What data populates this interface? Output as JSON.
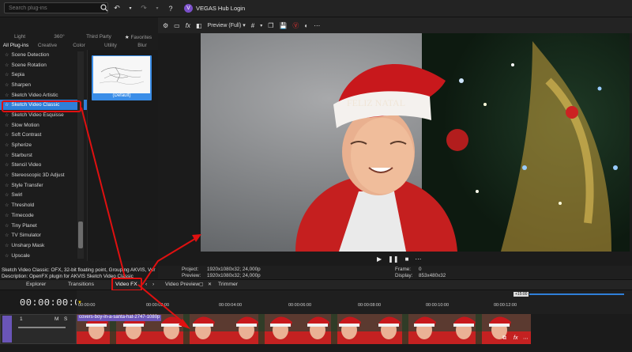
{
  "window": {
    "title": "VEGAS Hub Login",
    "logo_letter": "V"
  },
  "plugin_panel": {
    "search_placeholder": "Search plug-ins",
    "category_row1": [
      "Light",
      "360°",
      "Third Party",
      "Favorites"
    ],
    "category_row2": [
      "All Plug-ins",
      "Creative",
      "Color",
      "Utility",
      "Blur"
    ],
    "plugins": [
      "Scene Detection",
      "Scene Rotation",
      "Sepia",
      "Sharpen",
      "Sketch Video Artistic",
      "Sketch Video Classic",
      "Sketch Video Esquisse",
      "Slow Motion",
      "Soft Contrast",
      "Spherize",
      "Starburst",
      "Stencil Video",
      "Stereoscopic 3D Adjust",
      "Style Transfer",
      "Swirl",
      "Threshold",
      "Timecode",
      "Tiny Planet",
      "TV Simulator",
      "Unsharp Mask",
      "Upscale"
    ],
    "selected_plugin": "Sketch Video Classic",
    "preset_label": "(Default)"
  },
  "description": {
    "line1": "Sketch Video Classic: OFX, 32-bit floating point, Grouping AKVIS, Ver",
    "line2": "Description: OpenFX plugin for AKVIS Sketch Video Classic"
  },
  "preview": {
    "mode_label": "Preview (Full)",
    "project_label": "Project:",
    "project_value": "1920x1080x32; 24,000p",
    "preview_label": "Preview:",
    "preview_value": "1920x1080x32; 24,000p",
    "frame_label": "Frame:",
    "frame_value": "0",
    "display_label": "Display:",
    "display_value": "853x480x32",
    "hat_text": "FELIZ NATAL"
  },
  "tabs": [
    "Explorer",
    "Transitions",
    "Video FX",
    "Video Preview",
    "Trimmer"
  ],
  "timeline": {
    "timecode": "00:00:00:00",
    "ruler_ticks": [
      "00:00:00",
      "00:00:02:00",
      "00:00:04:00",
      "00:00:06:00",
      "00:00:08:00",
      "00:00:10:00",
      "00:00:12:00"
    ],
    "zoom_label": "+15:00",
    "track_number": "1",
    "track_m": "M",
    "track_s": "S",
    "clip_name": "covers-boy-in-a-santa-hat-2747-1080p"
  },
  "colors": {
    "accent": "#2f7fd9",
    "highlight": "#e01010",
    "clip": "#6c56b9"
  }
}
